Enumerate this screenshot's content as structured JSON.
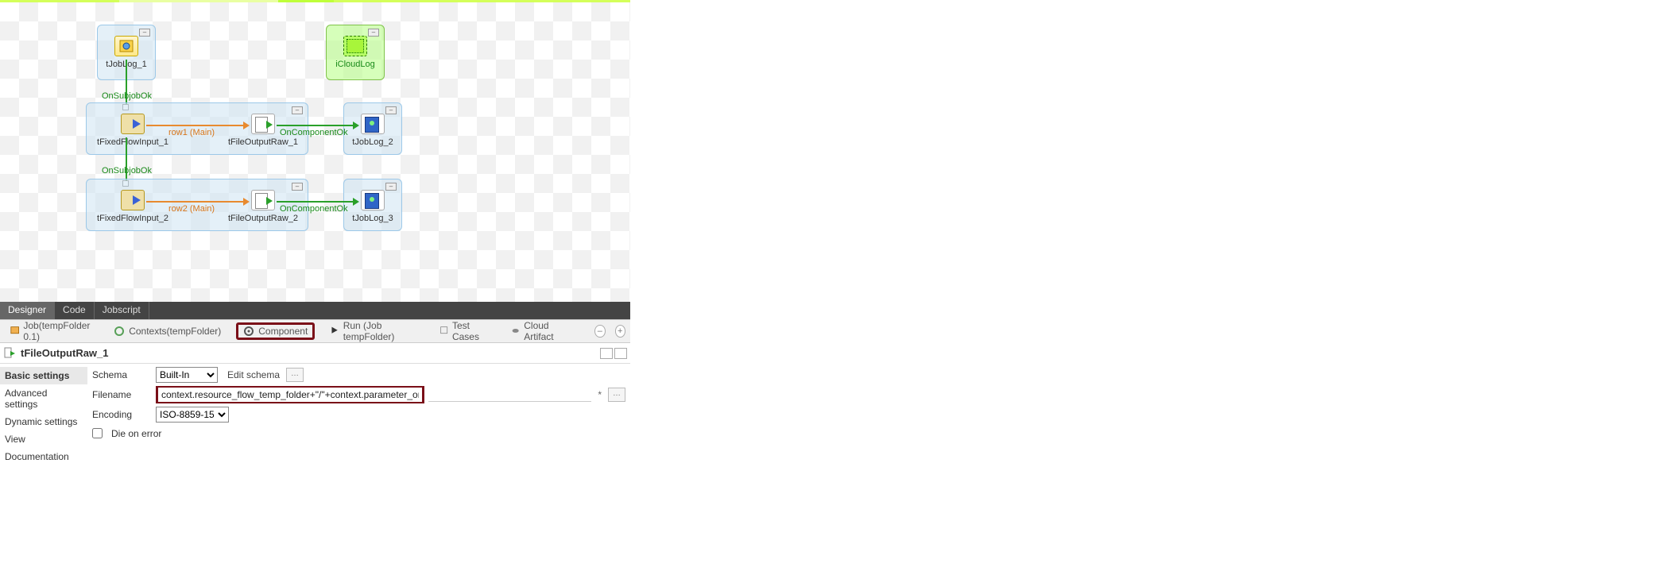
{
  "canvas": {
    "node_tJobLog1": "tJobLog_1",
    "node_iCloudLog": "iCloudLog",
    "node_tFixedFlowInput1": "tFixedFlowInput_1",
    "node_tFileOutputRaw1": "tFileOutputRaw_1",
    "node_tJobLog2": "tJobLog_2",
    "node_tFixedFlowInput2": "tFixedFlowInput_2",
    "node_tFileOutputRaw2": "tFileOutputRaw_2",
    "node_tJobLog3": "tJobLog_3",
    "link_onSubjobOk1": "OnSubjobOk",
    "link_onSubjobOk2": "OnSubjobOk",
    "link_row1": "row1 (Main)",
    "link_row2": "row2 (Main)",
    "link_onComponentOk1": "OnComponentOk",
    "link_onComponentOk2": "OnComponentOk"
  },
  "tabs": {
    "designer": "Designer",
    "code": "Code",
    "jobscript": "Jobscript"
  },
  "viewbar": {
    "job": "Job(tempFolder 0.1)",
    "contexts": "Contexts(tempFolder)",
    "component": "Component",
    "run": "Run (Job tempFolder)",
    "testcases": "Test Cases",
    "cloudartifact": "Cloud Artifact"
  },
  "selected_component": "tFileOutputRaw_1",
  "settings_nav": {
    "basic": "Basic settings",
    "advanced": "Advanced settings",
    "dynamic": "Dynamic settings",
    "view": "View",
    "documentation": "Documentation"
  },
  "form": {
    "schema_label": "Schema",
    "schema_value": "Built-In",
    "edit_schema": "Edit schema",
    "filename_label": "Filename",
    "filename_value": "context.resource_flow_temp_folder+\"/\"+context.parameter_one",
    "encoding_label": "Encoding",
    "encoding_value": "ISO-8859-15",
    "die_on_error": "Die on error",
    "asterisk": "*"
  }
}
